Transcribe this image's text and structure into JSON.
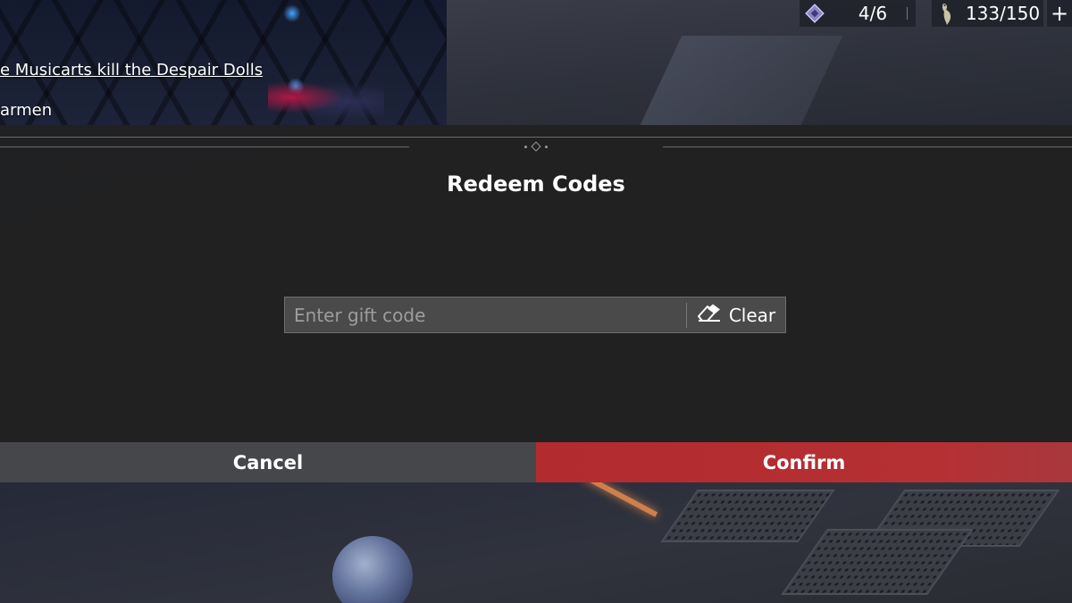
{
  "hud": {
    "quest_title": "e Musicarts kill the Despair Dolls",
    "quest_subtitle": "armen",
    "ticket_count": "4/6",
    "stamina_count": "133/150",
    "plus_symbol": "+",
    "ticket_icon": "ticket-icon",
    "stamina_icon": "heron-icon"
  },
  "dialog": {
    "title": "Redeem Codes",
    "code_input": {
      "value": "",
      "placeholder": "Enter gift code"
    },
    "clear_label": "Clear",
    "clear_icon": "eraser-icon",
    "cancel_label": "Cancel",
    "confirm_label": "Confirm"
  },
  "colors": {
    "confirm_accent": "#b22b2f",
    "cancel_bg": "#45474a",
    "dialog_bg": "#212121",
    "input_bg": "#4a4a4a"
  }
}
